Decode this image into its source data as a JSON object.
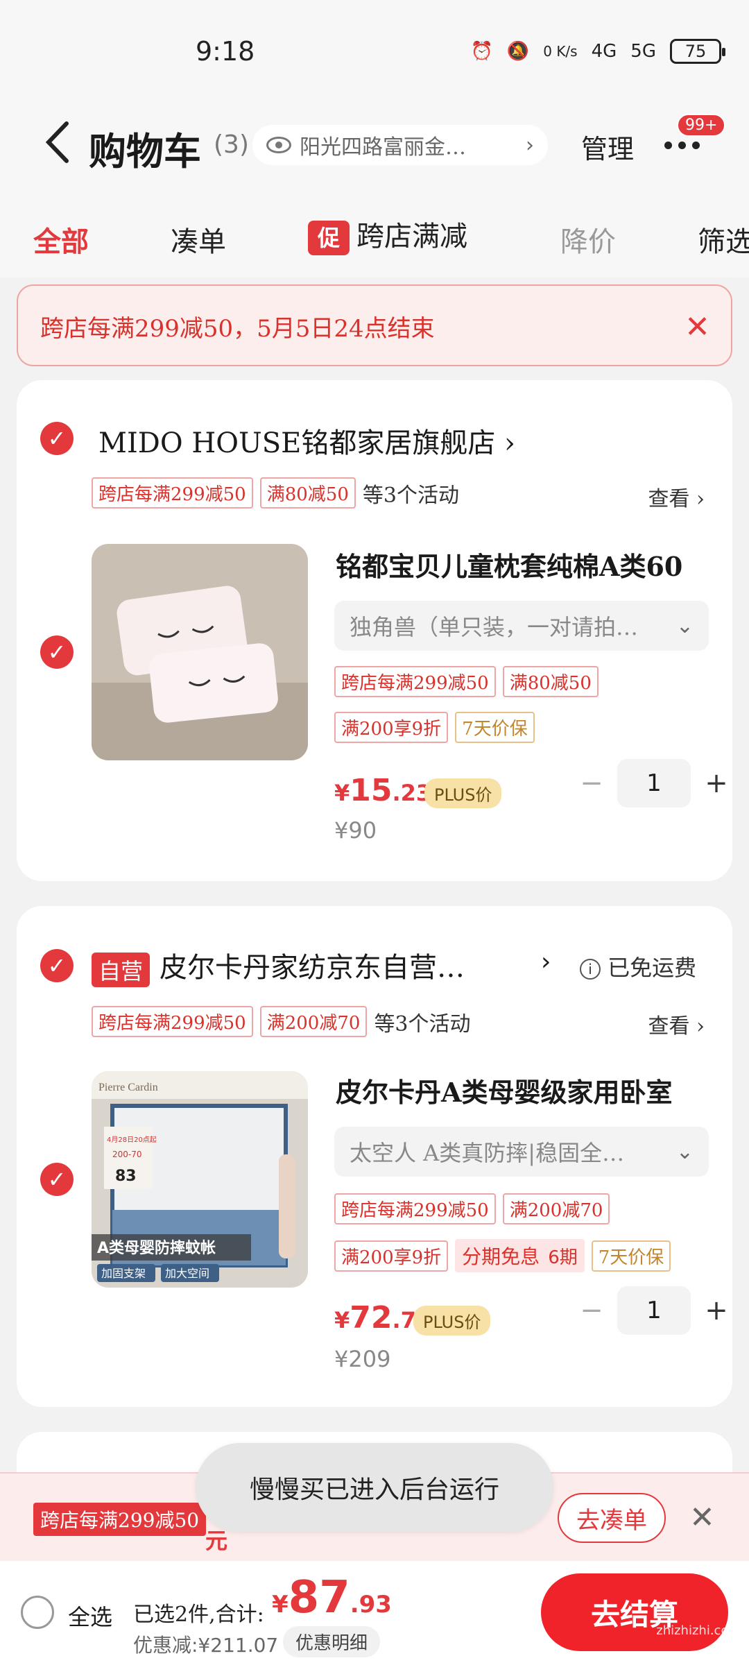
{
  "status_bar": {
    "time": "9:18",
    "net_speed": "0 K/s",
    "signal1": "4G",
    "signal2": "5G",
    "battery": "75"
  },
  "header": {
    "title": "购物车",
    "count": "(3)",
    "address": "阳光四路富丽金…",
    "manage": "管理",
    "badge": "99+"
  },
  "tabs": [
    {
      "label": "全部"
    },
    {
      "label": "凑单"
    },
    {
      "label": "跨店满减",
      "badge": "促"
    },
    {
      "label": "降价"
    },
    {
      "label": "筛选"
    }
  ],
  "notice": {
    "text": "跨店每满299减50，5月5日24点结束"
  },
  "shops": [
    {
      "name": "MIDO HOUSE铭都家居旗舰店",
      "self_run": "",
      "shipping": "",
      "tags": [
        "跨店每满299减50",
        "满80减50"
      ],
      "activities": "等3个活动",
      "look": "查看",
      "product": {
        "title": "铭都宝贝儿童枕套纯棉A类60",
        "variant": "独角兽（单只装，一对请拍…",
        "tags_row1": [
          "跨店每满299减50",
          "满80减50"
        ],
        "tags_row2": [
          "满200享9折",
          "7天价保"
        ],
        "price_currency": "¥",
        "price_int": "15",
        "price_dec": ".23",
        "plus_label": "PLUS价",
        "orig_price": "¥90",
        "qty": "1"
      }
    },
    {
      "name": "皮尔卡丹家纺京东自营…",
      "self_run": "自营",
      "shipping": "已免运费",
      "tags": [
        "跨店每满299减50",
        "满200减70"
      ],
      "activities": "等3个活动",
      "look": "查看",
      "product": {
        "title": "皮尔卡丹A类母婴级家用卧室",
        "variant": "太空人 A类真防摔|稳固全…",
        "tags_row1": [
          "跨店每满299减50",
          "满200减70"
        ],
        "tags_row2": [
          "满200享9折",
          "7天价保"
        ],
        "installment": {
          "label": "分期免息",
          "periods": "6期"
        },
        "price_currency": "¥",
        "price_int": "72",
        "price_dec": ".7",
        "plus_label": "PLUS价",
        "orig_price": "¥209",
        "qty": "1",
        "image_text": {
          "brand": "Pierre Cardin",
          "main": "A类母婴防摔蚊帐",
          "sub1": "加固支架",
          "sub2": "加大空间",
          "date": "4月28日20点起",
          "deal": "200-70",
          "price": "83"
        }
      }
    }
  ],
  "promo_bar": {
    "tag": "跨店每满299减50",
    "yuan": "元",
    "button": "去凑单"
  },
  "toast": "慢慢买已进入后台运行",
  "checkout": {
    "select_all": "全选",
    "selected": "已选2件,合计:",
    "currency": "¥",
    "total_int": "87",
    "total_dec": ".93",
    "discount": "优惠减:¥211.07",
    "discount_detail": "优惠明细",
    "settle": "去结算"
  },
  "watermark": "zhizhizhi.com",
  "colors": {
    "accent": "#e4393c",
    "background": "#f2f2f2"
  }
}
